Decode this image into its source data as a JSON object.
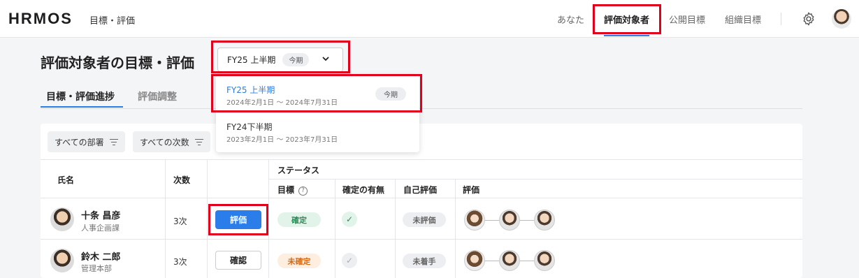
{
  "header": {
    "logo": "HRMOS",
    "app_title": "目標・評価",
    "nav": [
      "あなた",
      "評価対象者",
      "公開目標",
      "組織目標"
    ],
    "active_nav": "評価対象者",
    "icons": [
      "gear-icon",
      "user-avatar"
    ]
  },
  "page": {
    "title": "評価対象者の目標・評価",
    "period_select": {
      "value": "FY25 上半期",
      "badge": "今期"
    },
    "tabs": [
      "目標・評価進捗",
      "評価調整"
    ],
    "active_tab": "目標・評価進捗"
  },
  "dropdown": {
    "options": [
      {
        "label": "FY25 上半期",
        "range": "2024年2月1日 〜 2024年7月31日",
        "badge": "今期",
        "selected": true
      },
      {
        "label": "FY24下半期",
        "range": "2023年2月1日 〜 2023年7月31日",
        "badge": "",
        "selected": false
      }
    ]
  },
  "filters": [
    "すべての部署",
    "すべての次数"
  ],
  "table": {
    "headers": {
      "name": "氏名",
      "order": "次数",
      "status_group": "ステータス",
      "goal": "目標",
      "confirmed": "確定の有無",
      "self_eval": "自己評価",
      "evaluation": "評価"
    },
    "rows": [
      {
        "name": "十条 昌彦",
        "dept": "人事企画課",
        "order": "3次",
        "action": "評価",
        "goal": "確定",
        "confirmed": "✓",
        "self_eval": "未評価"
      },
      {
        "name": "鈴木 二郎",
        "dept": "管理本部",
        "order": "3次",
        "action": "確認",
        "goal": "未確定",
        "confirmed": "✓",
        "self_eval": "未着手"
      }
    ]
  },
  "colors": {
    "accent": "#2b7de9",
    "highlight": "#e0001b",
    "success": "#2a8a56",
    "warning": "#d46b1a"
  }
}
